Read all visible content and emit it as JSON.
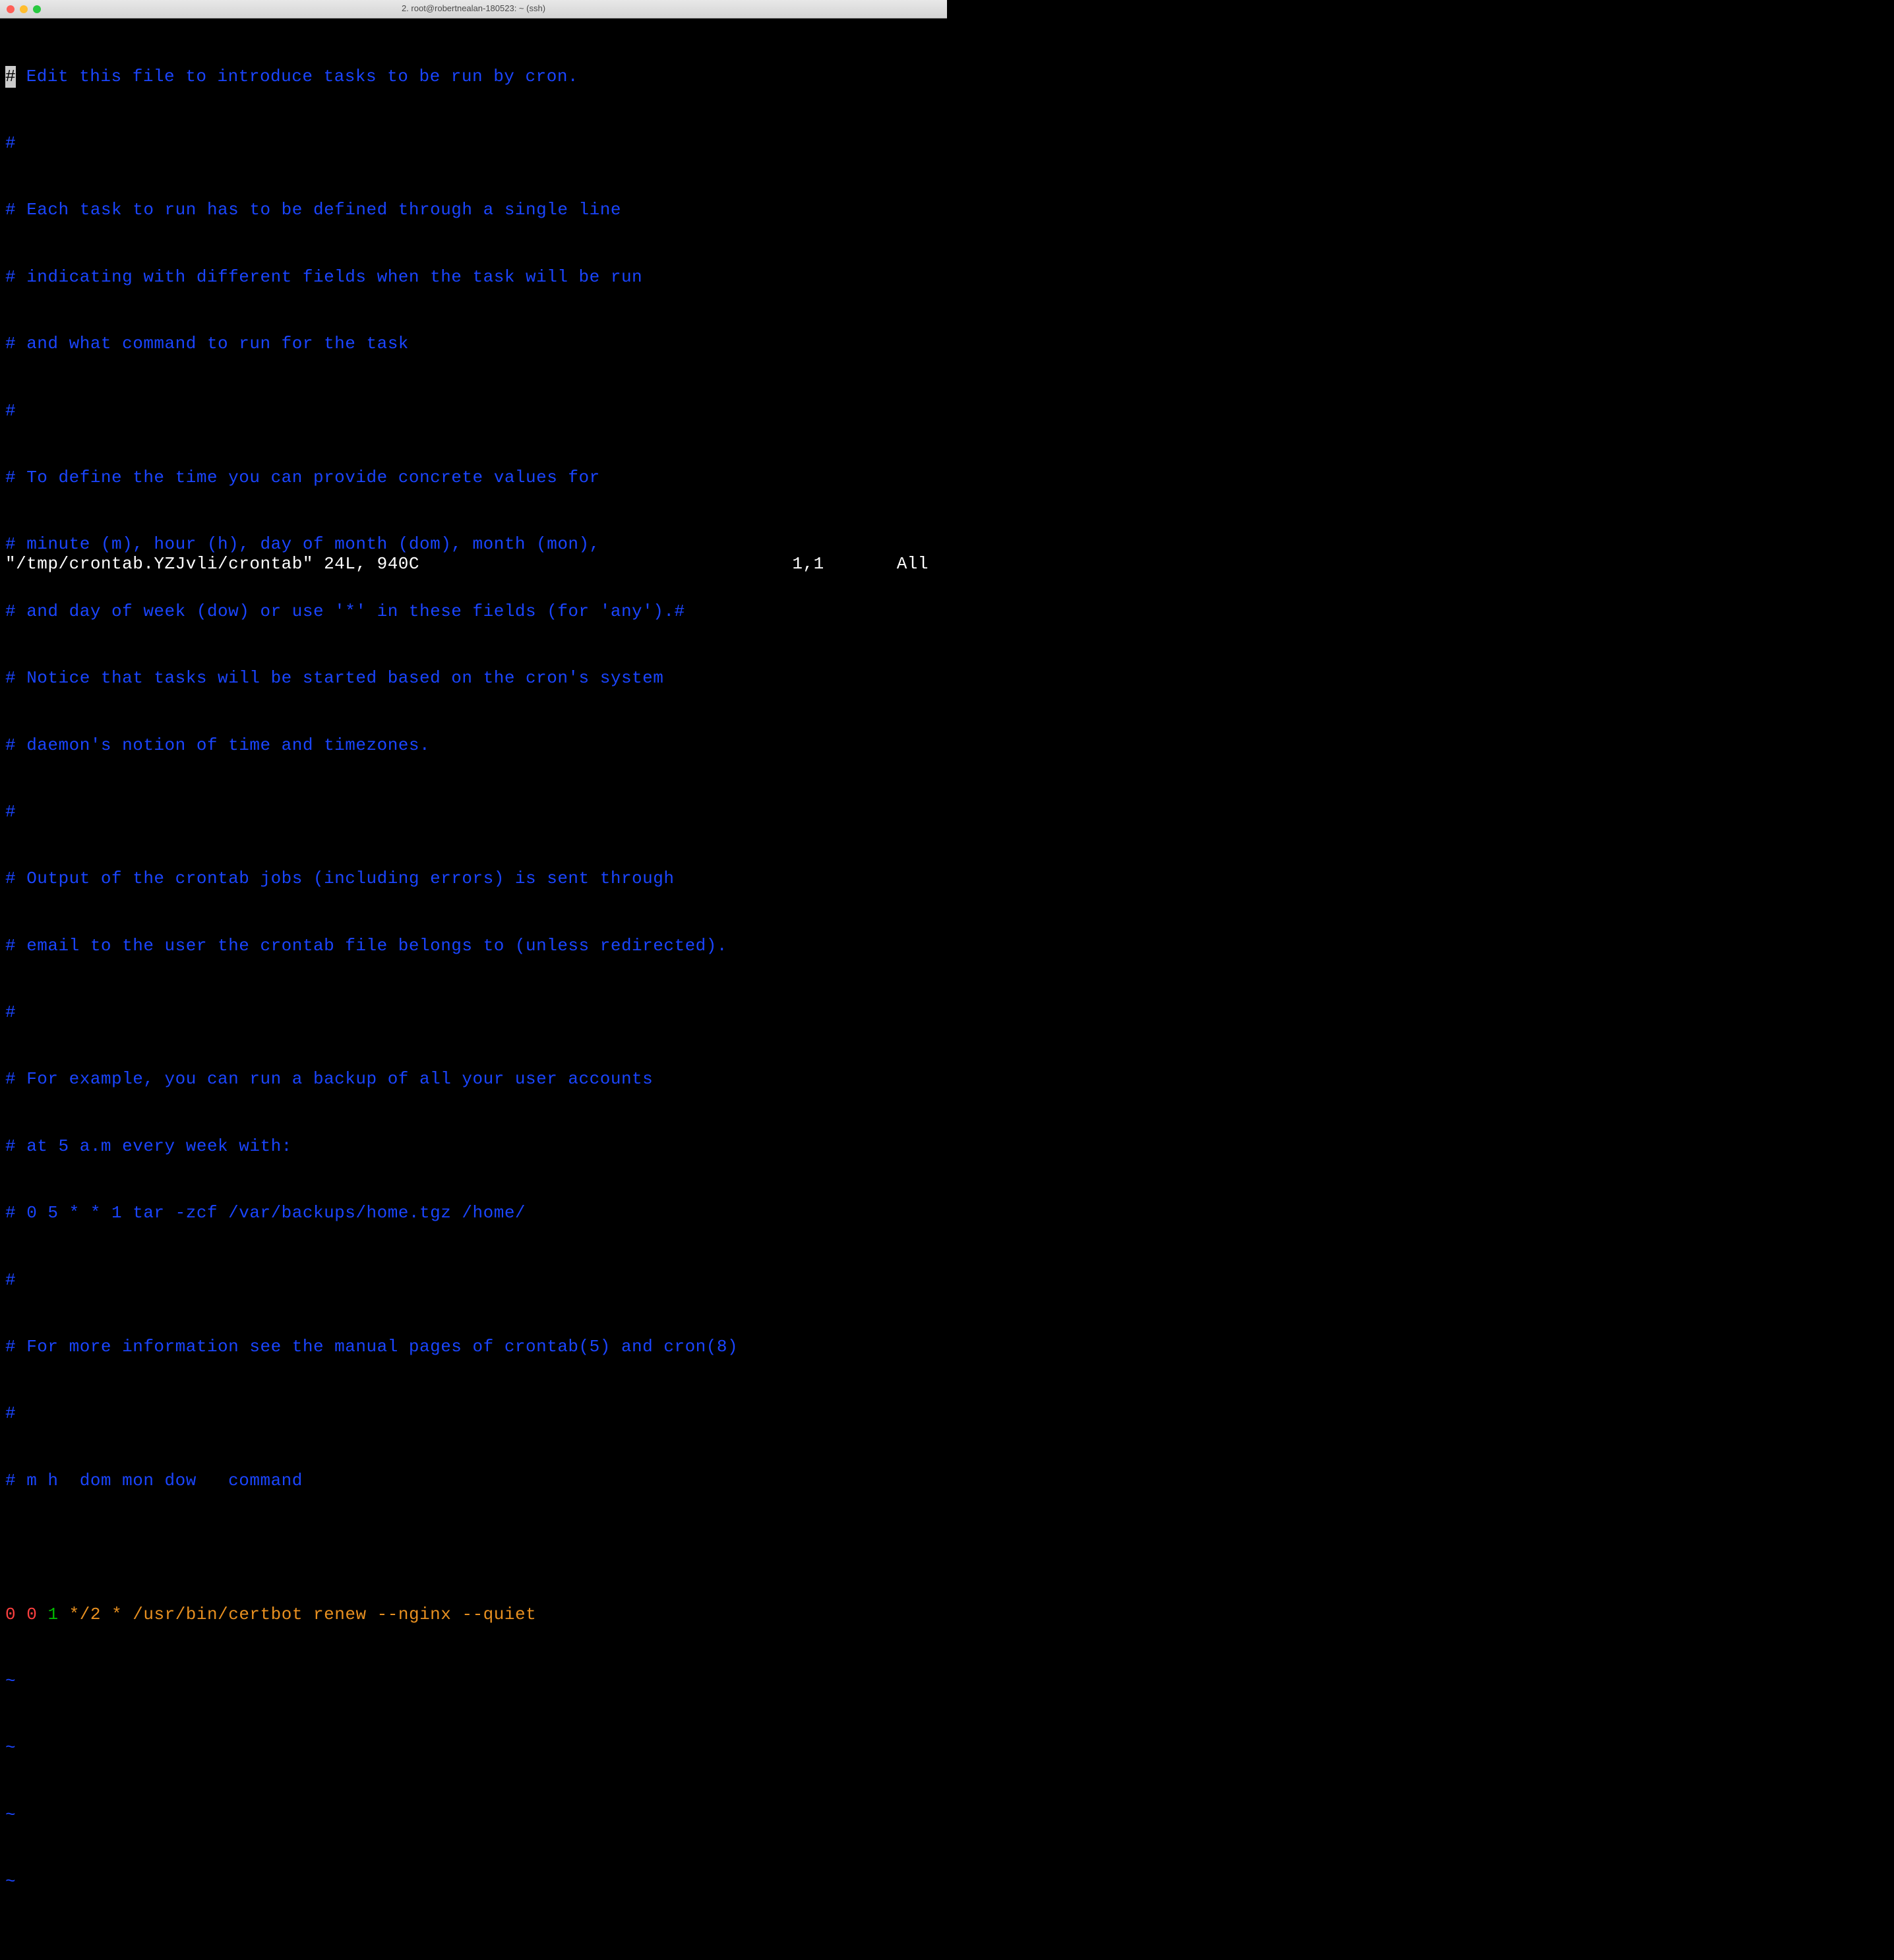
{
  "window": {
    "title": "2. root@robertnealan-180523: ~ (ssh)"
  },
  "editor": {
    "cursor_char": "#",
    "lines": [
      " Edit this file to introduce tasks to be run by cron.",
      "#",
      "# Each task to run has to be defined through a single line",
      "# indicating with different fields when the task will be run",
      "# and what command to run for the task",
      "#",
      "# To define the time you can provide concrete values for",
      "# minute (m), hour (h), day of month (dom), month (mon),",
      "# and day of week (dow) or use '*' in these fields (for 'any').#",
      "# Notice that tasks will be started based on the cron's system",
      "# daemon's notion of time and timezones.",
      "#",
      "# Output of the crontab jobs (including errors) is sent through",
      "# email to the user the crontab file belongs to (unless redirected).",
      "#",
      "# For example, you can run a backup of all your user accounts",
      "# at 5 a.m every week with:",
      "# 0 5 * * 1 tar -zcf /var/backups/home.tgz /home/",
      "#",
      "# For more information see the manual pages of crontab(5) and cron(8)",
      "#",
      "# m h  dom mon dow   command"
    ],
    "blank_line": "",
    "cron_entry": {
      "f1": "0",
      "f2": "0",
      "f3": "1",
      "f4": "*/2",
      "f5": "*",
      "command": "/usr/bin/certbot renew --nginx --quiet"
    },
    "tilde": "~"
  },
  "status": {
    "file": "\"/tmp/crontab.YZJvli/crontab\" 24L, 940C",
    "position": "1,1",
    "percent": "All"
  }
}
